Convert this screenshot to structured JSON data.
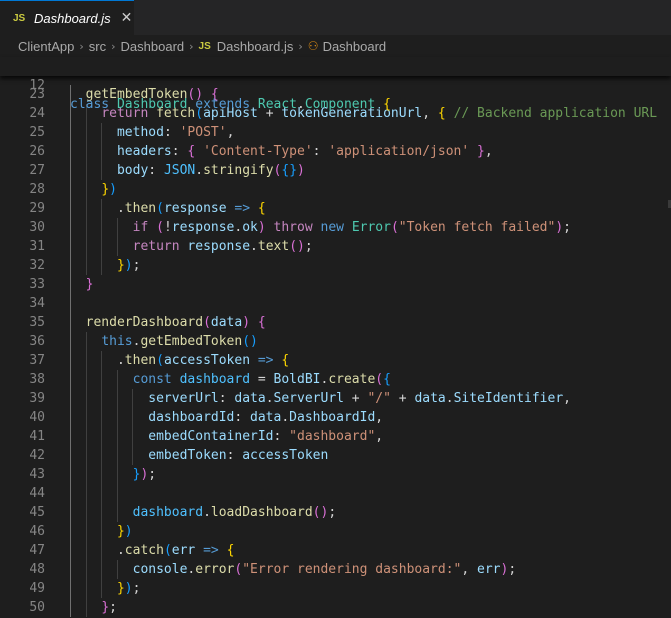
{
  "tab": {
    "badge": "JS",
    "title": "Dashboard.js",
    "close": "✕"
  },
  "breadcrumb": [
    {
      "label": "ClientApp"
    },
    {
      "label": "src"
    },
    {
      "label": "Dashboard"
    },
    {
      "badge": "JS",
      "label": "Dashboard.js"
    },
    {
      "label": "Dashboard",
      "icon": "component-symbol-icon"
    }
  ],
  "sticky_line": {
    "num": "12",
    "tokens": [
      [
        "kw",
        "class"
      ],
      [
        "pn",
        " "
      ],
      [
        "cls",
        "Dashboard"
      ],
      [
        "pn",
        " "
      ],
      [
        "kw",
        "extends"
      ],
      [
        "pn",
        " "
      ],
      [
        "cls",
        "React"
      ],
      [
        "pn",
        "."
      ],
      [
        "cls",
        "Component"
      ],
      [
        "pn",
        " "
      ],
      [
        "b1",
        "{"
      ]
    ]
  },
  "lines": [
    {
      "num": "23",
      "g": [
        1
      ],
      "tokens": [
        [
          "pn",
          "  "
        ],
        [
          "fn",
          "getEmbedToken"
        ],
        [
          "b2",
          "("
        ],
        [
          "b2",
          ")"
        ],
        [
          "pn",
          " "
        ],
        [
          "b2",
          "{"
        ]
      ]
    },
    {
      "num": "24",
      "g": [
        1,
        2
      ],
      "tokens": [
        [
          "pn",
          "    "
        ],
        [
          "ctl",
          "return"
        ],
        [
          "pn",
          " "
        ],
        [
          "fn",
          "fetch"
        ],
        [
          "b3",
          "("
        ],
        [
          "var",
          "apiHost"
        ],
        [
          "pn",
          " + "
        ],
        [
          "var",
          "tokenGenerationUrl"
        ],
        [
          "pn",
          ", "
        ],
        [
          "b1",
          "{"
        ],
        [
          "pn",
          " "
        ],
        [
          "cm",
          "// Backend application URL"
        ]
      ]
    },
    {
      "num": "25",
      "g": [
        1,
        2,
        3
      ],
      "tokens": [
        [
          "pn",
          "      "
        ],
        [
          "var",
          "method"
        ],
        [
          "pn",
          ": "
        ],
        [
          "str",
          "'POST'"
        ],
        [
          "pn",
          ","
        ]
      ]
    },
    {
      "num": "26",
      "g": [
        1,
        2,
        3
      ],
      "tokens": [
        [
          "pn",
          "      "
        ],
        [
          "var",
          "headers"
        ],
        [
          "pn",
          ": "
        ],
        [
          "b2",
          "{"
        ],
        [
          "pn",
          " "
        ],
        [
          "str",
          "'Content-Type'"
        ],
        [
          "pn",
          ": "
        ],
        [
          "str",
          "'application/json'"
        ],
        [
          "pn",
          " "
        ],
        [
          "b2",
          "}"
        ],
        [
          "pn",
          ","
        ]
      ]
    },
    {
      "num": "27",
      "g": [
        1,
        2,
        3
      ],
      "tokens": [
        [
          "pn",
          "      "
        ],
        [
          "var",
          "body"
        ],
        [
          "pn",
          ": "
        ],
        [
          "cst",
          "JSON"
        ],
        [
          "pn",
          "."
        ],
        [
          "fn",
          "stringify"
        ],
        [
          "b2",
          "("
        ],
        [
          "b3",
          "{"
        ],
        [
          "b3",
          "}"
        ],
        [
          "b2",
          ")"
        ]
      ]
    },
    {
      "num": "28",
      "g": [
        1,
        2
      ],
      "tokens": [
        [
          "pn",
          "    "
        ],
        [
          "b1",
          "}"
        ],
        [
          "b3",
          ")"
        ]
      ]
    },
    {
      "num": "29",
      "g": [
        1,
        2,
        3
      ],
      "tokens": [
        [
          "pn",
          "      ."
        ],
        [
          "fn",
          "then"
        ],
        [
          "b3",
          "("
        ],
        [
          "var",
          "response"
        ],
        [
          "pn",
          " "
        ],
        [
          "kw",
          "=>"
        ],
        [
          "pn",
          " "
        ],
        [
          "b1",
          "{"
        ]
      ]
    },
    {
      "num": "30",
      "g": [
        1,
        2,
        3,
        4
      ],
      "tokens": [
        [
          "pn",
          "        "
        ],
        [
          "ctl",
          "if"
        ],
        [
          "pn",
          " "
        ],
        [
          "b2",
          "("
        ],
        [
          "pn",
          "!"
        ],
        [
          "var",
          "response"
        ],
        [
          "pn",
          "."
        ],
        [
          "var",
          "ok"
        ],
        [
          "b2",
          ")"
        ],
        [
          "pn",
          " "
        ],
        [
          "ctl",
          "throw"
        ],
        [
          "pn",
          " "
        ],
        [
          "kw",
          "new"
        ],
        [
          "pn",
          " "
        ],
        [
          "cls",
          "Error"
        ],
        [
          "b2",
          "("
        ],
        [
          "str",
          "\"Token fetch failed\""
        ],
        [
          "b2",
          ")"
        ],
        [
          "pn",
          ";"
        ]
      ]
    },
    {
      "num": "31",
      "g": [
        1,
        2,
        3,
        4
      ],
      "tokens": [
        [
          "pn",
          "        "
        ],
        [
          "ctl",
          "return"
        ],
        [
          "pn",
          " "
        ],
        [
          "var",
          "response"
        ],
        [
          "pn",
          "."
        ],
        [
          "fn",
          "text"
        ],
        [
          "b2",
          "("
        ],
        [
          "b2",
          ")"
        ],
        [
          "pn",
          ";"
        ]
      ]
    },
    {
      "num": "32",
      "g": [
        1,
        2,
        3
      ],
      "tokens": [
        [
          "pn",
          "      "
        ],
        [
          "b1",
          "}"
        ],
        [
          "b3",
          ")"
        ],
        [
          "pn",
          ";"
        ]
      ]
    },
    {
      "num": "33",
      "g": [
        1
      ],
      "tokens": [
        [
          "pn",
          "  "
        ],
        [
          "b2",
          "}"
        ]
      ]
    },
    {
      "num": "34",
      "g": [
        1
      ],
      "tokens": []
    },
    {
      "num": "35",
      "g": [
        1
      ],
      "tokens": [
        [
          "pn",
          "  "
        ],
        [
          "fn",
          "renderDashboard"
        ],
        [
          "b2",
          "("
        ],
        [
          "var",
          "data"
        ],
        [
          "b2",
          ")"
        ],
        [
          "pn",
          " "
        ],
        [
          "b2",
          "{"
        ]
      ]
    },
    {
      "num": "36",
      "g": [
        1,
        2
      ],
      "tokens": [
        [
          "pn",
          "    "
        ],
        [
          "kw",
          "this"
        ],
        [
          "pn",
          "."
        ],
        [
          "fn",
          "getEmbedToken"
        ],
        [
          "b3",
          "("
        ],
        [
          "b3",
          ")"
        ]
      ]
    },
    {
      "num": "37",
      "g": [
        1,
        2,
        3
      ],
      "tokens": [
        [
          "pn",
          "      ."
        ],
        [
          "fn",
          "then"
        ],
        [
          "b3",
          "("
        ],
        [
          "var",
          "accessToken"
        ],
        [
          "pn",
          " "
        ],
        [
          "kw",
          "=>"
        ],
        [
          "pn",
          " "
        ],
        [
          "b1",
          "{"
        ]
      ]
    },
    {
      "num": "38",
      "g": [
        1,
        2,
        3,
        4
      ],
      "tokens": [
        [
          "pn",
          "        "
        ],
        [
          "kw",
          "const"
        ],
        [
          "pn",
          " "
        ],
        [
          "cst",
          "dashboard"
        ],
        [
          "pn",
          " = "
        ],
        [
          "var",
          "BoldBI"
        ],
        [
          "pn",
          "."
        ],
        [
          "fn",
          "create"
        ],
        [
          "b2",
          "("
        ],
        [
          "b3",
          "{"
        ]
      ]
    },
    {
      "num": "39",
      "g": [
        1,
        2,
        3,
        4,
        5
      ],
      "tokens": [
        [
          "pn",
          "          "
        ],
        [
          "var",
          "serverUrl"
        ],
        [
          "pn",
          ": "
        ],
        [
          "var",
          "data"
        ],
        [
          "pn",
          "."
        ],
        [
          "var",
          "ServerUrl"
        ],
        [
          "pn",
          " + "
        ],
        [
          "str",
          "\"/\""
        ],
        [
          "pn",
          " + "
        ],
        [
          "var",
          "data"
        ],
        [
          "pn",
          "."
        ],
        [
          "var",
          "SiteIdentifier"
        ],
        [
          "pn",
          ","
        ]
      ]
    },
    {
      "num": "40",
      "g": [
        1,
        2,
        3,
        4,
        5
      ],
      "tokens": [
        [
          "pn",
          "          "
        ],
        [
          "var",
          "dashboardId"
        ],
        [
          "pn",
          ": "
        ],
        [
          "var",
          "data"
        ],
        [
          "pn",
          "."
        ],
        [
          "var",
          "DashboardId"
        ],
        [
          "pn",
          ","
        ]
      ]
    },
    {
      "num": "41",
      "g": [
        1,
        2,
        3,
        4,
        5
      ],
      "tokens": [
        [
          "pn",
          "          "
        ],
        [
          "var",
          "embedContainerId"
        ],
        [
          "pn",
          ": "
        ],
        [
          "str",
          "\"dashboard\""
        ],
        [
          "pn",
          ","
        ]
      ]
    },
    {
      "num": "42",
      "g": [
        1,
        2,
        3,
        4,
        5
      ],
      "tokens": [
        [
          "pn",
          "          "
        ],
        [
          "var",
          "embedToken"
        ],
        [
          "pn",
          ": "
        ],
        [
          "var",
          "accessToken"
        ]
      ]
    },
    {
      "num": "43",
      "g": [
        1,
        2,
        3,
        4
      ],
      "tokens": [
        [
          "pn",
          "        "
        ],
        [
          "b3",
          "}"
        ],
        [
          "b2",
          ")"
        ],
        [
          "pn",
          ";"
        ]
      ]
    },
    {
      "num": "44",
      "g": [
        1,
        2,
        3,
        4
      ],
      "tokens": []
    },
    {
      "num": "45",
      "g": [
        1,
        2,
        3,
        4
      ],
      "tokens": [
        [
          "pn",
          "        "
        ],
        [
          "cst",
          "dashboard"
        ],
        [
          "pn",
          "."
        ],
        [
          "fn",
          "loadDashboard"
        ],
        [
          "b2",
          "("
        ],
        [
          "b2",
          ")"
        ],
        [
          "pn",
          ";"
        ]
      ]
    },
    {
      "num": "46",
      "g": [
        1,
        2,
        3
      ],
      "tokens": [
        [
          "pn",
          "      "
        ],
        [
          "b1",
          "}"
        ],
        [
          "b3",
          ")"
        ]
      ]
    },
    {
      "num": "47",
      "g": [
        1,
        2,
        3
      ],
      "tokens": [
        [
          "pn",
          "      ."
        ],
        [
          "fn",
          "catch"
        ],
        [
          "b3",
          "("
        ],
        [
          "var",
          "err"
        ],
        [
          "pn",
          " "
        ],
        [
          "kw",
          "=>"
        ],
        [
          "pn",
          " "
        ],
        [
          "b1",
          "{"
        ]
      ]
    },
    {
      "num": "48",
      "g": [
        1,
        2,
        3,
        4
      ],
      "tokens": [
        [
          "pn",
          "        "
        ],
        [
          "var",
          "console"
        ],
        [
          "pn",
          "."
        ],
        [
          "fn",
          "error"
        ],
        [
          "b2",
          "("
        ],
        [
          "str",
          "\"Error rendering dashboard:\""
        ],
        [
          "pn",
          ", "
        ],
        [
          "var",
          "err"
        ],
        [
          "b2",
          ")"
        ],
        [
          "pn",
          ";"
        ]
      ]
    },
    {
      "num": "49",
      "g": [
        1,
        2,
        3
      ],
      "tokens": [
        [
          "pn",
          "      "
        ],
        [
          "b1",
          "}"
        ],
        [
          "b3",
          ")"
        ],
        [
          "pn",
          ";"
        ]
      ]
    },
    {
      "num": "50",
      "g": [
        1,
        2
      ],
      "tokens": [
        [
          "pn",
          "    "
        ],
        [
          "b2",
          "}"
        ],
        [
          "pn",
          ";"
        ]
      ]
    }
  ]
}
